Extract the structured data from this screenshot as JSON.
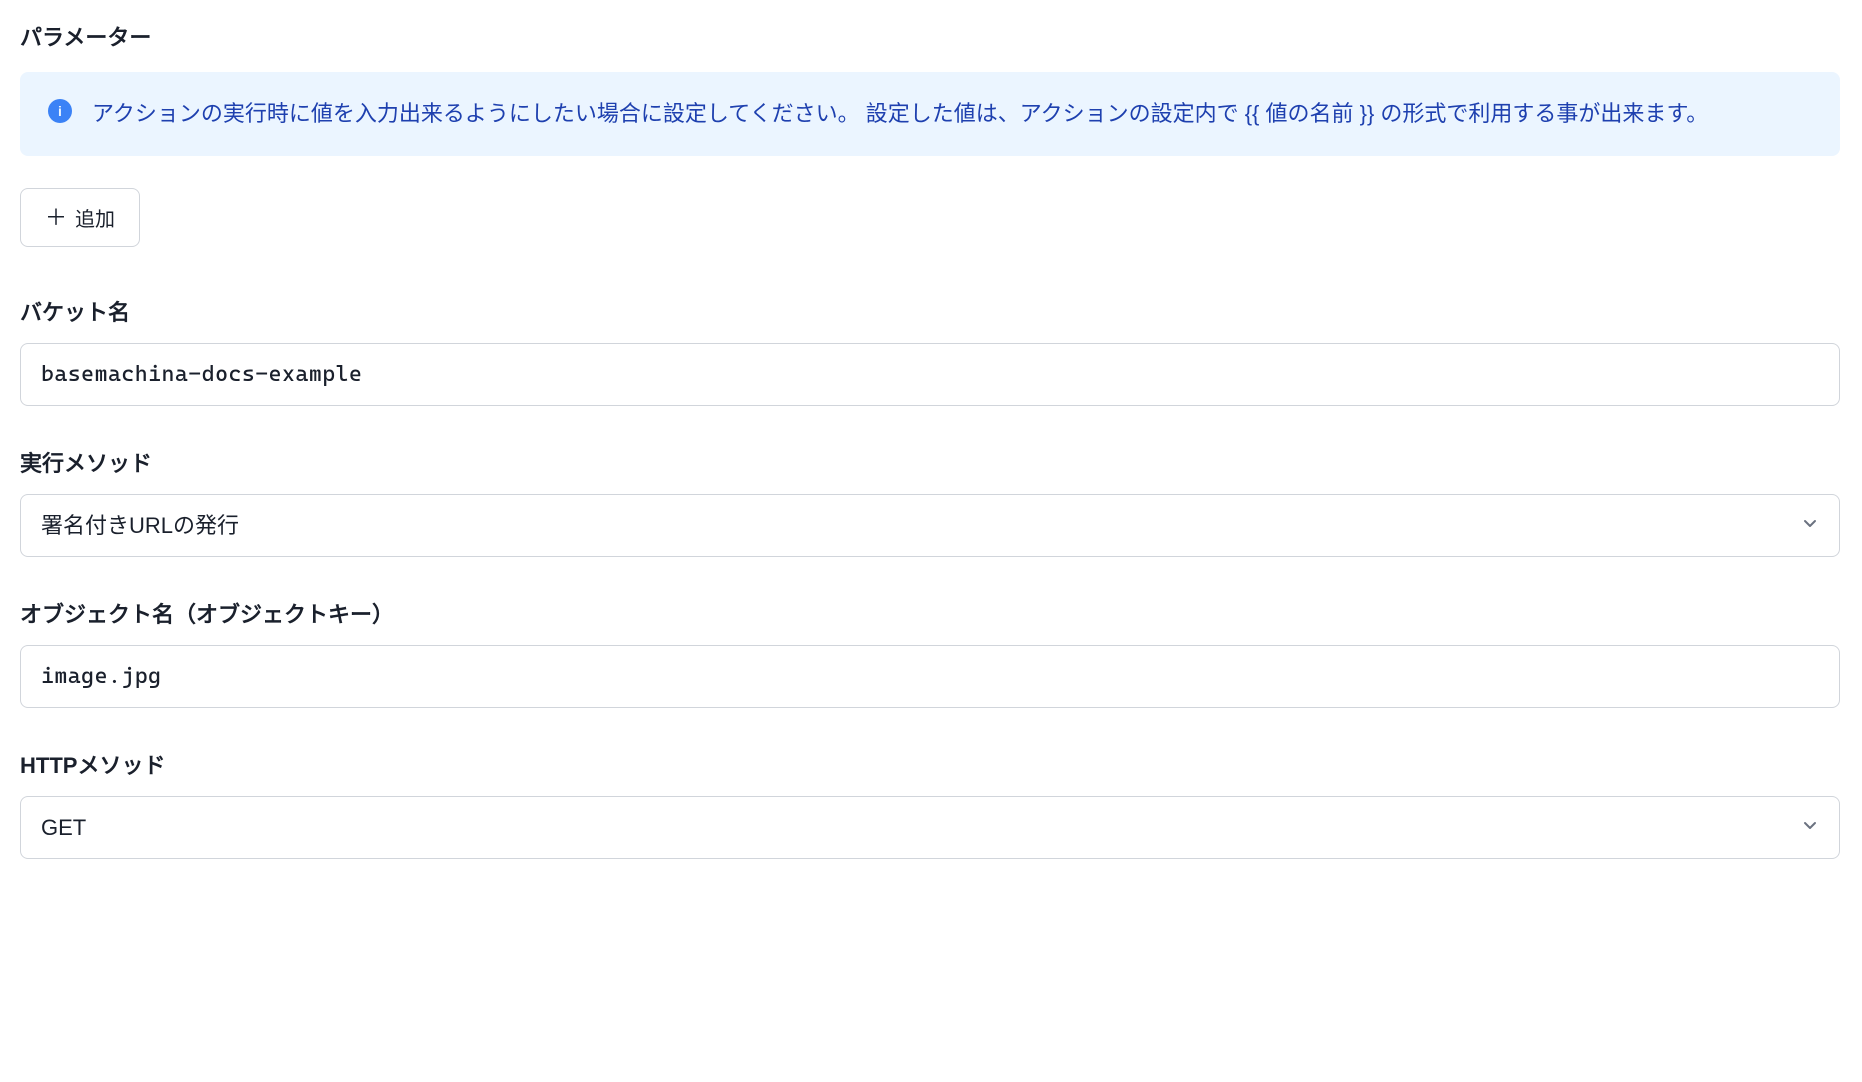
{
  "parameters": {
    "title": "パラメーター",
    "info_text": "アクションの実行時に値を入力出来るようにしたい場合に設定してください。 設定した値は、アクションの設定内で {{ 値の名前 }} の形式で利用する事が出来ます。",
    "add_button_label": "追加"
  },
  "fields": {
    "bucket_name": {
      "label": "バケット名",
      "value": "basemachina-docs-example"
    },
    "execution_method": {
      "label": "実行メソッド",
      "value": "署名付きURLの発行"
    },
    "object_name": {
      "label": "オブジェクト名（オブジェクトキー）",
      "value": "image.jpg"
    },
    "http_method": {
      "label": "HTTPメソッド",
      "value": "GET"
    }
  }
}
